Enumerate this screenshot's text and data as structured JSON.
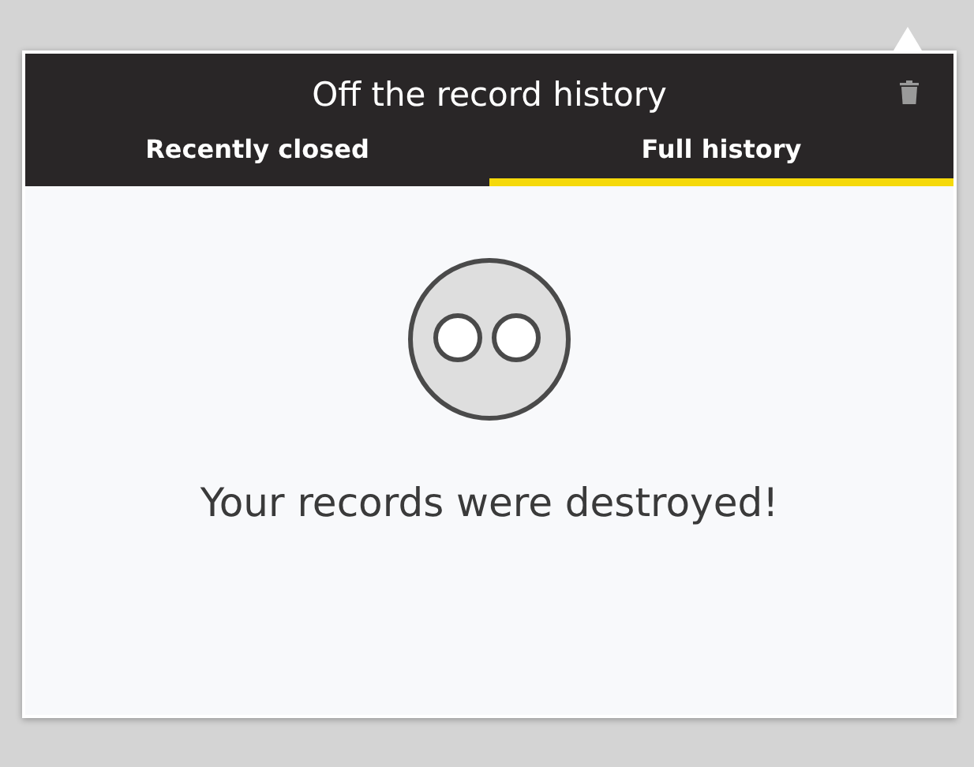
{
  "header": {
    "title": "Off the record history"
  },
  "tabs": [
    {
      "label": "Recently closed",
      "selected": false
    },
    {
      "label": "Full history",
      "selected": true
    }
  ],
  "empty_state": {
    "message": "Your records were destroyed!"
  }
}
